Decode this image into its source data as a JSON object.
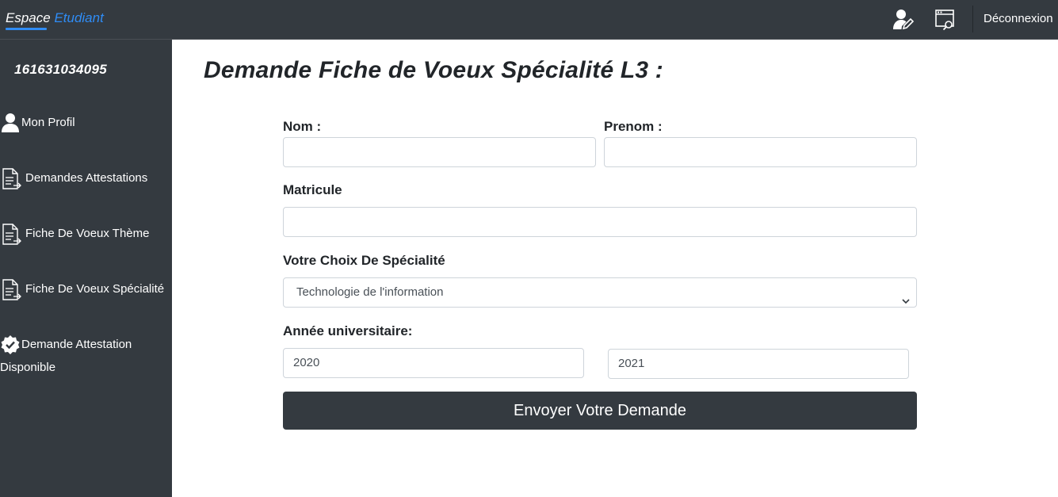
{
  "navbar": {
    "brand_part1": "Espace",
    "brand_part2": "Etudiant",
    "icons": [
      "user-edit-icon",
      "document-search-icon"
    ],
    "logout_label": "Déconnexion"
  },
  "sidebar": {
    "student_id": "161631034095",
    "items": [
      {
        "label": "Mon Profil",
        "icon": "user-icon"
      },
      {
        "label": "Demandes Attestations",
        "icon": "document-icon"
      },
      {
        "label": "Fiche De Voeux Thème",
        "icon": "document-icon"
      },
      {
        "label": "Fiche De Voeux Spécialité",
        "icon": "document-icon"
      },
      {
        "label_line1": "Demande Attestation",
        "label_line2": "Disponible",
        "icon": "verified-badge-icon"
      }
    ]
  },
  "main": {
    "title": "Demande Fiche de Voeux Spécialité L3 :",
    "form": {
      "nom_label": "Nom :",
      "nom_value": "",
      "prenom_label": "Prenom :",
      "prenom_value": "",
      "matricule_label": "Matricule",
      "matricule_value": "",
      "specialite_label": "Votre Choix De Spécialité",
      "specialite_selected": "Technologie de l'information",
      "annee_label": "Année universitaire:",
      "annee_start": "2020",
      "annee_end": "2021",
      "submit_label": "Envoyer Votre Demande"
    }
  },
  "colors": {
    "dark": "#343a40",
    "accent": "#2f8cf5",
    "border": "#ced4da"
  }
}
